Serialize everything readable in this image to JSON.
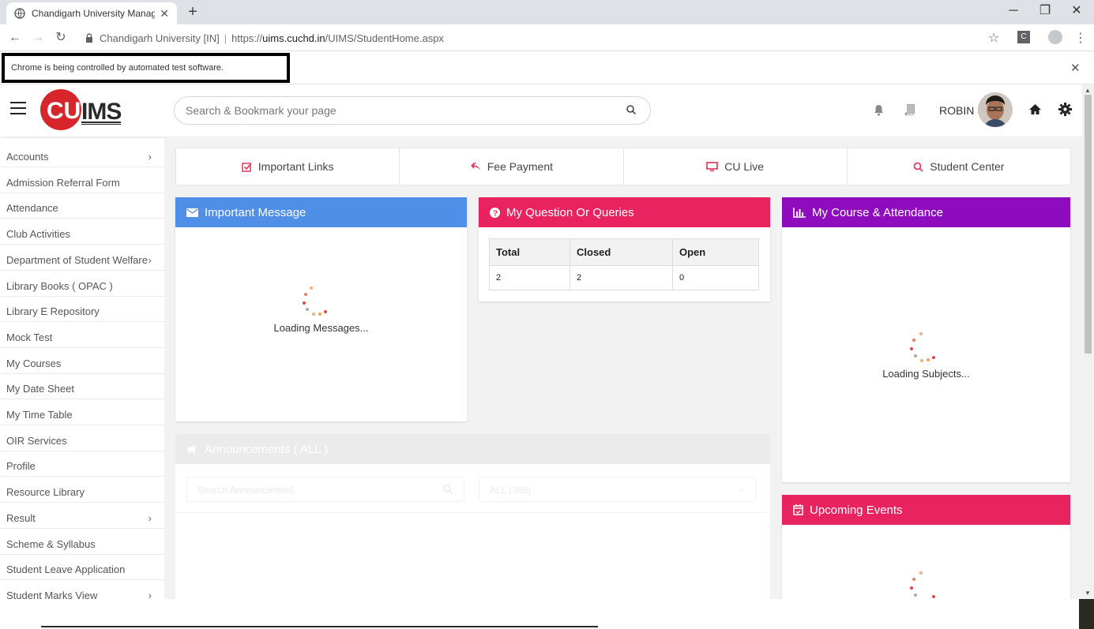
{
  "browser": {
    "tab_title": "Chandigarh University Managem",
    "site_label": "Chandigarh University [IN]",
    "url_prefix": "https://",
    "url_host": "uims.cuchd.in",
    "url_path": "/UIMS/StudentHome.aspx",
    "infobar_text": "Chrome is being controlled by automated test software."
  },
  "header": {
    "logo_text": "CU IMS",
    "search_placeholder": "Search & Bookmark your page",
    "username": "ROBIN"
  },
  "sidebar": {
    "items": [
      {
        "label": "Accounts",
        "chevron": true
      },
      {
        "label": "Admission Referral Form",
        "chevron": false
      },
      {
        "label": "Attendance",
        "chevron": false
      },
      {
        "label": "Club Activities",
        "chevron": false
      },
      {
        "label": "Department of Student Welfare",
        "chevron": true
      },
      {
        "label": "Library Books ( OPAC )",
        "chevron": false
      },
      {
        "label": "Library E Repository",
        "chevron": false
      },
      {
        "label": "Mock Test",
        "chevron": false
      },
      {
        "label": "My Courses",
        "chevron": false
      },
      {
        "label": "My Date Sheet",
        "chevron": false
      },
      {
        "label": "My Time Table",
        "chevron": false
      },
      {
        "label": "OIR Services",
        "chevron": false
      },
      {
        "label": "Profile",
        "chevron": false
      },
      {
        "label": "Resource Library",
        "chevron": false
      },
      {
        "label": "Result",
        "chevron": true
      },
      {
        "label": "Scheme & Syllabus",
        "chevron": false
      },
      {
        "label": "Student Leave Application",
        "chevron": false
      },
      {
        "label": "Student Marks View",
        "chevron": true
      }
    ]
  },
  "quicklinks": [
    {
      "label": "Important Links",
      "icon": "checkbox-icon",
      "color": "#e23c5f"
    },
    {
      "label": "Fee Payment",
      "icon": "reply-all-icon",
      "color": "#e23c5f"
    },
    {
      "label": "CU Live",
      "icon": "monitor-icon",
      "color": "#e23c5f"
    },
    {
      "label": "Student Center",
      "icon": "search-icon",
      "color": "#e23c5f"
    }
  ],
  "cards": {
    "important_message": {
      "title": "Important Message",
      "loading": "Loading Messages...",
      "color": "#4f8fe8"
    },
    "queries": {
      "title": "My Question Or Queries",
      "color": "#e8235f",
      "headers": [
        "Total",
        "Closed",
        "Open"
      ],
      "values": [
        "2",
        "2",
        "0"
      ]
    },
    "course_attendance": {
      "title": "My Course & Attendance",
      "loading": "Loading Subjects...",
      "color": "#8e0cbd"
    },
    "announcements": {
      "title": "Announcements ( ALL )",
      "search_placeholder": "Search Announcement",
      "filter_value": "ALL (369)"
    },
    "upcoming_events": {
      "title": "Upcoming Events",
      "color": "#e8235f"
    }
  }
}
